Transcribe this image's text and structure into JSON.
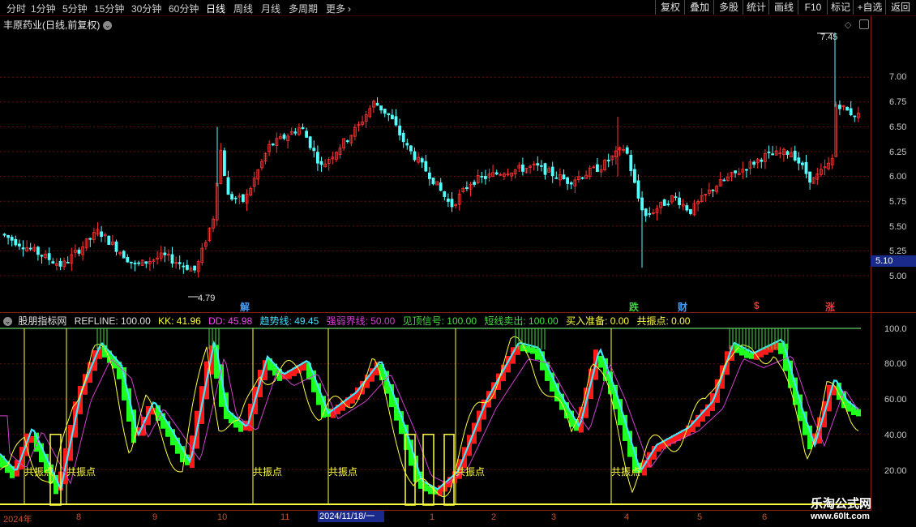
{
  "toolbar": {
    "periods": [
      "分时",
      "1分钟",
      "5分钟",
      "15分钟",
      "30分钟",
      "60分钟",
      "日线",
      "周线",
      "月线",
      "多周期",
      "更多"
    ],
    "more_icon": "chevron-right-icon",
    "buttons": [
      "复权",
      "叠加",
      "多股",
      "统计",
      "画线",
      "F10",
      "标记",
      "+自选",
      "返回"
    ]
  },
  "stock": {
    "title": "丰原药业(日线,前复权)"
  },
  "price_axis": {
    "labels": [
      "7.00",
      "6.75",
      "6.50",
      "6.25",
      "6.00",
      "5.75",
      "5.50",
      "5.25",
      "5.00"
    ],
    "current": "5.10"
  },
  "markers": {
    "high": "7.45",
    "low": "4.79"
  },
  "events": [
    {
      "text": "解",
      "color": "#40a0ff"
    },
    {
      "text": "跌",
      "color": "#40d040"
    },
    {
      "text": "财",
      "color": "#40a0ff"
    },
    {
      "text": "$",
      "color": "#ff3030"
    },
    {
      "text": "涨",
      "color": "#ff3030"
    }
  ],
  "indicator": {
    "name": "股朋指标网",
    "fields": [
      {
        "text": "REFLINE: 100.00",
        "color": "#e0e0e0"
      },
      {
        "text": "KK: 41.96",
        "color": "#ffff40"
      },
      {
        "text": "DD: 45.98",
        "color": "#ff40ff"
      },
      {
        "text": "趋势线: 49.45",
        "color": "#40e0ff"
      },
      {
        "text": "强弱界线: 50.00",
        "color": "#d040d0"
      },
      {
        "text": "见顶信号: 100.00",
        "color": "#40e040"
      },
      {
        "text": "短线卖出: 100.00",
        "color": "#40e040"
      },
      {
        "text": "买入准备: 0.00",
        "color": "#ffff40"
      },
      {
        "text": "共振点: 0.00",
        "color": "#ffff40"
      }
    ],
    "axis": [
      "100.0",
      "80.00",
      "60.00",
      "40.00",
      "20.00"
    ],
    "resonance_label": "共振点"
  },
  "dates": [
    "2024年",
    "8",
    "9",
    "10",
    "11",
    "2024/11/18/一",
    "1",
    "2",
    "3",
    "4",
    "5",
    "6"
  ],
  "watermark": {
    "line1": "乐淘公式网",
    "line2": "www.60lt.com"
  },
  "chart_data": {
    "type": "candlestick",
    "title": "丰原药业(日线,前复权)",
    "price_range": [
      4.79,
      7.45
    ],
    "close_path_approx": [
      {
        "x": "2024年",
        "y": 5.4
      },
      {
        "x": "8",
        "y": 5.35
      },
      {
        "x": "9",
        "y": 5.15
      },
      {
        "x": "10",
        "y": 6.0
      },
      {
        "x": "11",
        "y": 6.4
      },
      {
        "x": "2024/11/18/一",
        "y": 6.6
      },
      {
        "x": "1",
        "y": 5.85
      },
      {
        "x": "2",
        "y": 6.05
      },
      {
        "x": "3",
        "y": 6.05
      },
      {
        "x": "4",
        "y": 5.6
      },
      {
        "x": "5",
        "y": 5.85
      },
      {
        "x": "6",
        "y": 6.65
      }
    ]
  }
}
